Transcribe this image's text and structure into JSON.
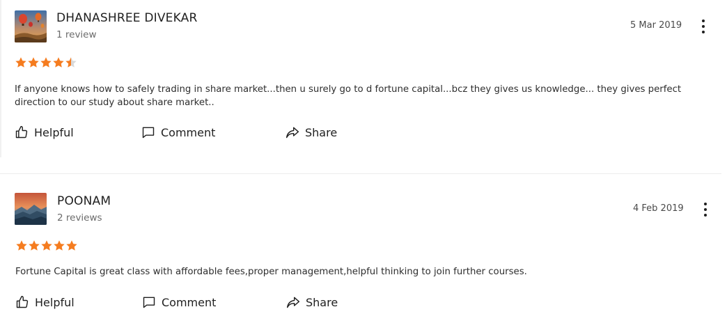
{
  "reviews": [
    {
      "author": "DHANASHREE DIVEKAR",
      "review_count": "1 review",
      "date": "5 Mar 2019",
      "rating": 4.5,
      "text": "If anyone knows how to safely trading in share market...then u surely go to d fortune capital...bcz they gives us knowledge... they gives perfect direction to our study about share market..",
      "avatar_icon": "hot-air-balloon-photo",
      "actions": {
        "helpful": "Helpful",
        "comment": "Comment",
        "share": "Share"
      }
    },
    {
      "author": "POONAM",
      "review_count": "2 reviews",
      "date": "4 Feb 2019",
      "rating": 5,
      "text": "Fortune Capital is great class with affordable fees,proper management,helpful thinking to join further courses.",
      "avatar_icon": "mountain-sunset-photo",
      "actions": {
        "helpful": "Helpful",
        "comment": "Comment",
        "share": "Share"
      }
    }
  ],
  "colors": {
    "star": "#f57c1f",
    "star_empty": "#d9d9d9",
    "text": "#2e2e2e",
    "divider": "#ececec"
  },
  "icons": {
    "helpful": "thumbs-up-icon",
    "comment": "comment-icon",
    "share": "share-arrow-icon",
    "more": "more-vertical-icon",
    "star": "star-icon"
  }
}
